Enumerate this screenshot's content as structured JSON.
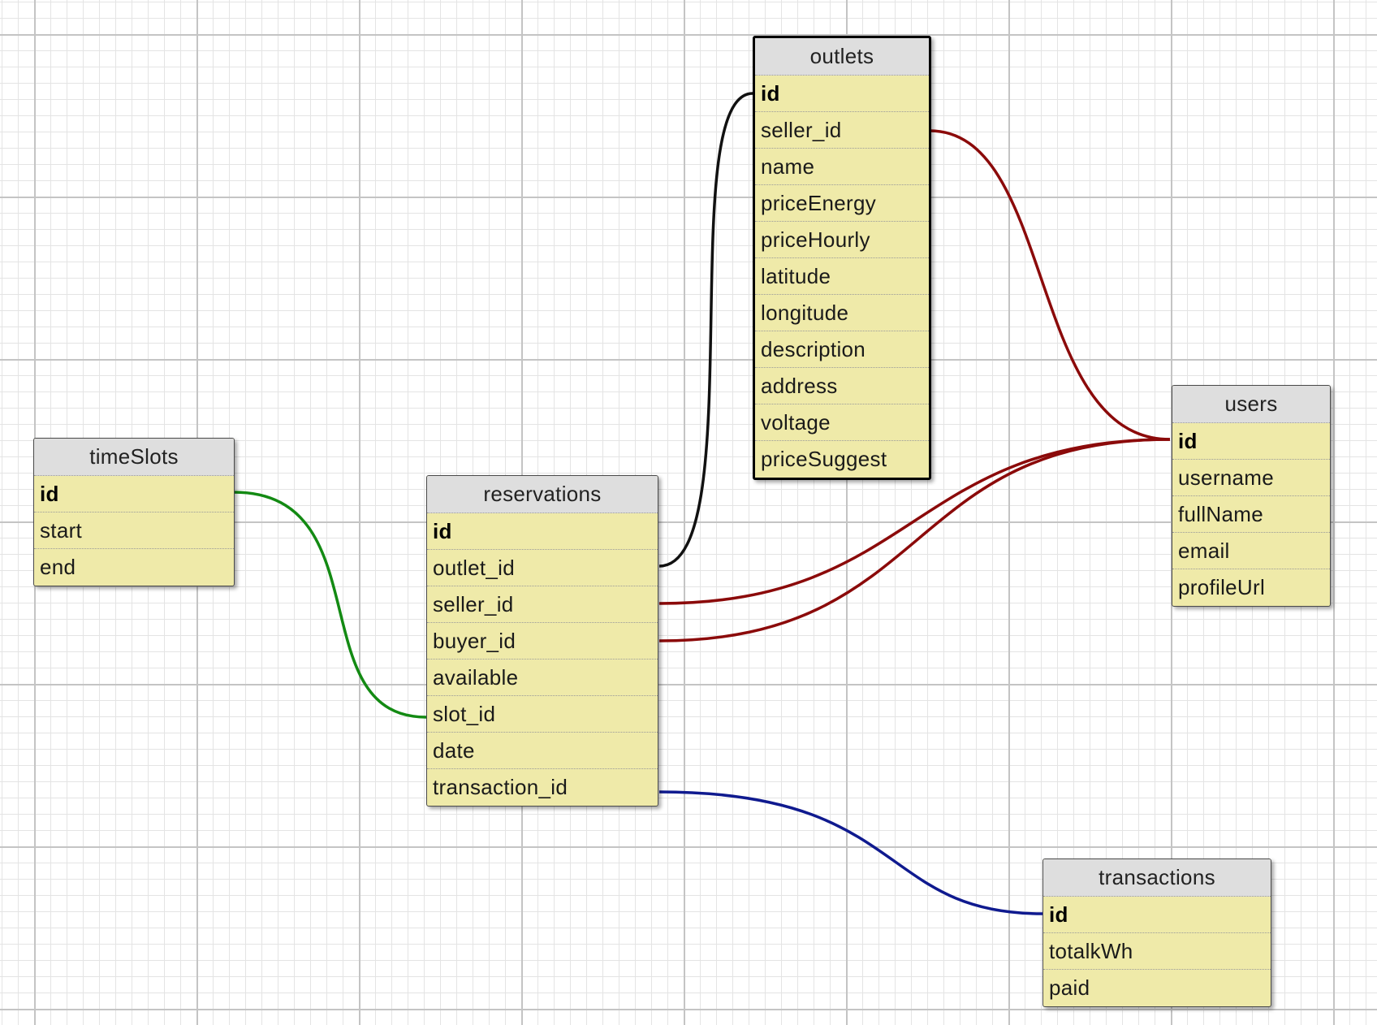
{
  "tables": {
    "timeSlots": {
      "title": "timeSlots",
      "fields": [
        "id",
        "start",
        "end"
      ]
    },
    "reservations": {
      "title": "reservations",
      "fields": [
        "id",
        "outlet_id",
        "seller_id",
        "buyer_id",
        "available",
        "slot_id",
        "date",
        "transaction_id"
      ]
    },
    "outlets": {
      "title": "outlets",
      "fields": [
        "id",
        "seller_id",
        "name",
        "priceEnergy",
        "priceHourly",
        "latitude",
        "longitude",
        "description",
        "address",
        "voltage",
        "priceSuggest"
      ]
    },
    "users": {
      "title": "users",
      "fields": [
        "id",
        "username",
        "fullName",
        "email",
        "profileUrl"
      ]
    },
    "transactions": {
      "title": "transactions",
      "fields": [
        "id",
        "totalkWh",
        "paid"
      ]
    }
  },
  "relations": [
    {
      "from": "reservations.outlet_id",
      "to": "outlets.id",
      "color": "#111111"
    },
    {
      "from": "outlets.seller_id",
      "to": "users.id",
      "color": "#8b0a0a"
    },
    {
      "from": "reservations.seller_id",
      "to": "users.id",
      "color": "#8b0a0a"
    },
    {
      "from": "reservations.buyer_id",
      "to": "users.id",
      "color": "#8b0a0a"
    },
    {
      "from": "timeSlots.id",
      "to": "reservations.slot_id",
      "color": "#138a13"
    },
    {
      "from": "reservations.transaction_id",
      "to": "transactions.id",
      "color": "#0f1a8f"
    }
  ]
}
